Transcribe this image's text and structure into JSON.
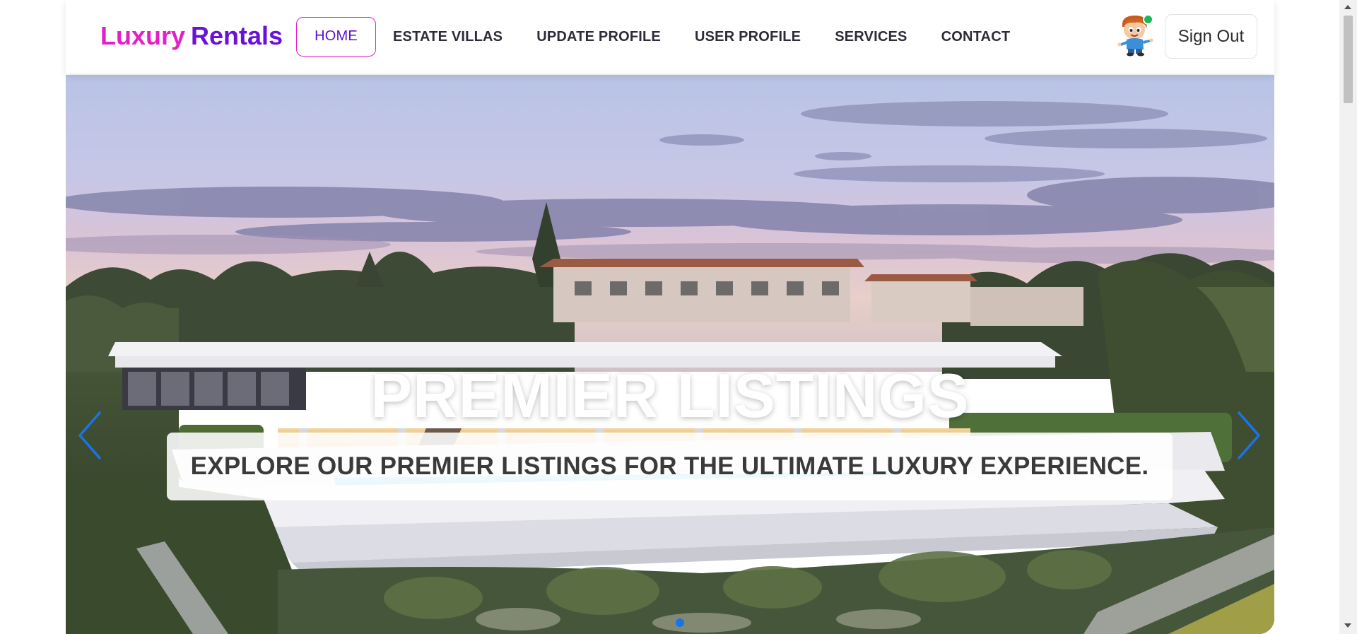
{
  "header": {
    "brand": {
      "part1": "Luxury",
      "part2": "Rentals"
    },
    "nav": [
      {
        "label": "HOME",
        "active": true
      },
      {
        "label": "ESTATE VILLAS",
        "active": false
      },
      {
        "label": "UPDATE PROFILE",
        "active": false
      },
      {
        "label": "USER PROFILE",
        "active": false
      },
      {
        "label": "SERVICES",
        "active": false
      },
      {
        "label": "CONTACT",
        "active": false
      }
    ],
    "avatar": {
      "icon": "cartoon-boy-avatar",
      "status": "online",
      "status_color": "#1fb55a"
    },
    "signout_label": "Sign Out"
  },
  "hero": {
    "title": "PREMIER LISTINGS",
    "caption": "EXPLORE OUR PREMIER LISTINGS FOR THE ULTIMATE LUXURY EXPERIENCE.",
    "image": "luxury-modern-villa-with-pool",
    "prev_icon": "chevron-left-icon",
    "next_icon": "chevron-right-icon",
    "slide_count": 1,
    "active_slide": 1
  },
  "colors": {
    "brand_pink": "#e51fc8",
    "brand_purple": "#6a11d9",
    "accent_blue": "#1a73e8",
    "nav_text": "#2d2d3a"
  }
}
